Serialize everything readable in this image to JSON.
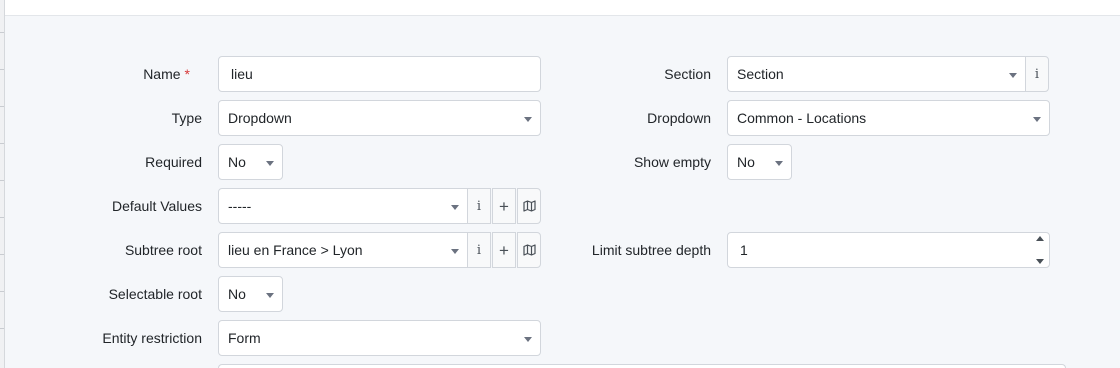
{
  "form": {
    "name": {
      "label": "Name",
      "required_mark": "*",
      "value": "lieu"
    },
    "section": {
      "label": "Section",
      "value": "Section",
      "info_icon": "info-icon"
    },
    "type": {
      "label": "Type",
      "value": "Dropdown"
    },
    "dropdown": {
      "label": "Dropdown",
      "value": "Common - Locations"
    },
    "required": {
      "label": "Required",
      "value": "No"
    },
    "show_empty": {
      "label": "Show empty",
      "value": "No"
    },
    "default_values": {
      "label": "Default Values",
      "value": "-----",
      "icons": [
        "info-icon",
        "plus-icon",
        "map-icon"
      ]
    },
    "subtree_root": {
      "label": "Subtree root",
      "value": "lieu en France > Lyon",
      "icons": [
        "info-icon",
        "plus-icon",
        "map-icon"
      ]
    },
    "limit_subtree_depth": {
      "label": "Limit subtree depth",
      "value": "1"
    },
    "selectable_root": {
      "label": "Selectable root",
      "value": "No"
    },
    "entity_restriction": {
      "label": "Entity restriction",
      "value": "Form"
    }
  },
  "colors": {
    "background": "#f5f7fa",
    "required_mark": "#d63939",
    "border": "#d2d6dc"
  }
}
